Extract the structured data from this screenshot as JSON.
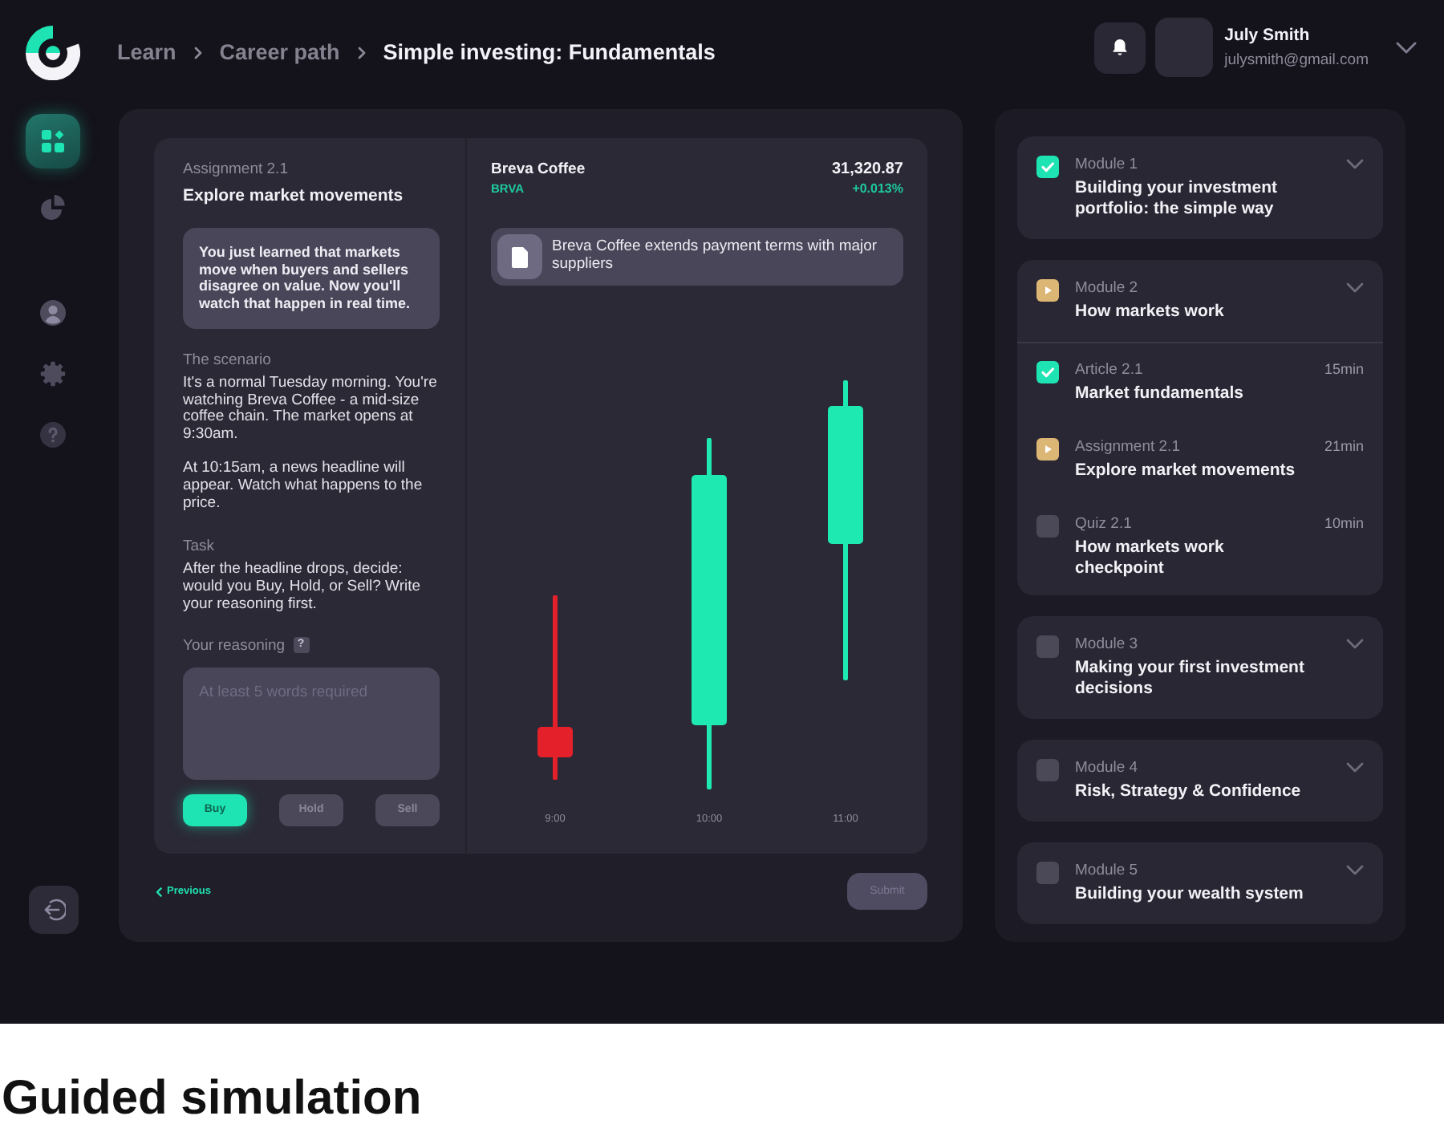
{
  "topbar": {
    "breadcrumb": [
      {
        "label": "Learn",
        "current": false
      },
      {
        "label": "Career path",
        "current": false
      },
      {
        "label": "Simple investing: Fundamentals",
        "current": true
      }
    ],
    "user": {
      "name": "July Smith",
      "email": "julysmith@gmail.com"
    }
  },
  "sidebar": {
    "groups": [
      {
        "items": [
          {
            "selected": true
          },
          {
            "selected": false
          }
        ]
      },
      {
        "items": [
          {
            "selected": false
          },
          {
            "selected": false
          },
          {
            "selected": false
          }
        ]
      }
    ]
  },
  "assignment": {
    "label": "Assignment 2.1",
    "title": "Explore market movements",
    "intro": "You just learned that markets move when buyers and sellers disagree on value. Now you'll watch that happen in real time.",
    "sections": [
      {
        "heading": "The scenario",
        "paragraphs": [
          "It's a normal Tuesday morning. You're watching Breva Coffee - a mid-size coffee chain. The market opens at 9:30am.",
          "At 10:15am, a news headline will appear. Watch what happens to the price."
        ]
      },
      {
        "heading": "Task",
        "paragraphs": [
          "After the headline drops, decide: would you Buy, Hold, or Sell? Write your reasoning first."
        ]
      }
    ],
    "reasoning": {
      "label": "Your reasoning",
      "hint": "?",
      "placeholder": "At least 5 words required"
    },
    "choices": [
      {
        "label": "Buy",
        "selected": true
      },
      {
        "label": "Hold",
        "selected": false
      },
      {
        "label": "Sell",
        "selected": false
      }
    ]
  },
  "stock": {
    "name": "Breva Coffee",
    "ticker": "BRVA",
    "price": "31,320.87",
    "change": "+0.013%",
    "headline": "Breva Coffee extends payment terms with major suppliers",
    "chart": {
      "x_labels": [
        "9:00",
        "10:00",
        "11:00"
      ]
    }
  },
  "footer": {
    "previous": "Previous",
    "submit": {
      "label": "Submit",
      "disabled": true
    }
  },
  "outline": {
    "modules": [
      {
        "label": "Module 1",
        "title": "Building your investment portfolio: the simple way",
        "kind": "done",
        "expanded": false
      },
      {
        "label": "Module 2",
        "title": "How markets work",
        "kind": "active",
        "expanded": true,
        "children": [
          {
            "label": "Article 2.1",
            "title": "Market fundamentals",
            "duration": "15min",
            "kind": "done"
          },
          {
            "label": "Assignment 2.1",
            "title": "Explore market movements",
            "duration": "21min",
            "kind": "active"
          },
          {
            "label": "Quiz 2.1",
            "title": "How markets work checkpoint",
            "duration": "10min",
            "kind": "todo"
          }
        ]
      },
      {
        "label": "Module 3",
        "title": "Making your first investment decisions",
        "kind": "todo",
        "expanded": false
      },
      {
        "label": "Module 4",
        "title": "Risk, Strategy & Confidence",
        "kind": "todo",
        "expanded": false
      },
      {
        "label": "Module 5",
        "title": "Building your wealth system",
        "kind": "todo",
        "expanded": false
      }
    ]
  },
  "caption": "Guided simulation"
}
